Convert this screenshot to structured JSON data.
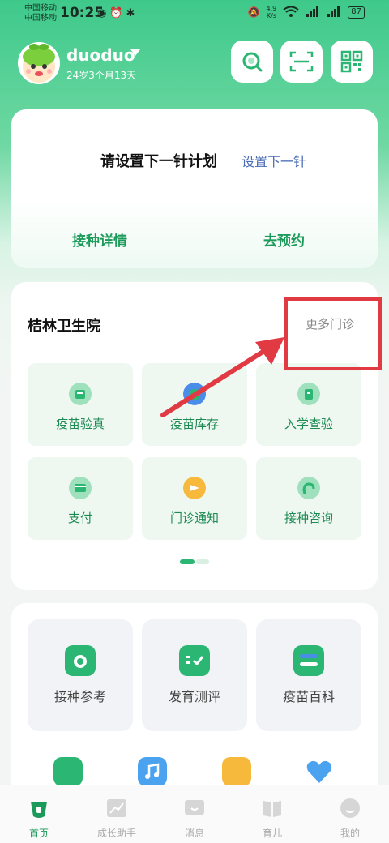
{
  "status_bar": {
    "carrier_1": "中国移动",
    "carrier_2": "中国移动",
    "time": "10:25",
    "net_speed_value": "4.9",
    "net_speed_unit": "K/s",
    "battery": "87"
  },
  "header": {
    "username": "duoduo",
    "age": "24岁3个月13天"
  },
  "plan_card": {
    "title": "请设置下一针计划",
    "set_link": "设置下一针",
    "details_button": "接种详情",
    "appointment_button": "去预约"
  },
  "clinic": {
    "name": "桔林卫生院",
    "more_link": "更多门诊",
    "tiles": [
      {
        "label": "疫苗验真",
        "icon": "vaccine-verify-icon"
      },
      {
        "label": "疫苗库存",
        "icon": "vaccine-stock-icon"
      },
      {
        "label": "入学查验",
        "icon": "school-check-icon"
      },
      {
        "label": "支付",
        "icon": "payment-icon"
      },
      {
        "label": "门诊通知",
        "icon": "clinic-notice-icon"
      },
      {
        "label": "接种咨询",
        "icon": "consult-icon"
      }
    ]
  },
  "tools": [
    {
      "label": "接种参考",
      "icon": "vaccination-reference-icon"
    },
    {
      "label": "发育测评",
      "icon": "development-assessment-icon"
    },
    {
      "label": "疫苗百科",
      "icon": "vaccine-encyclopedia-icon"
    }
  ],
  "tab_bar": [
    {
      "label": "首页",
      "icon": "home-icon",
      "active": true
    },
    {
      "label": "成长助手",
      "icon": "growth-chart-icon",
      "active": false
    },
    {
      "label": "消息",
      "icon": "message-icon",
      "active": false
    },
    {
      "label": "育儿",
      "icon": "parenting-book-icon",
      "active": false
    },
    {
      "label": "我的",
      "icon": "profile-icon",
      "active": false
    }
  ],
  "colors": {
    "brand_green": "#2bb673",
    "text_green": "#1b9a5a",
    "link_blue": "#4a6bb5",
    "annotation_red": "#e23a43"
  }
}
